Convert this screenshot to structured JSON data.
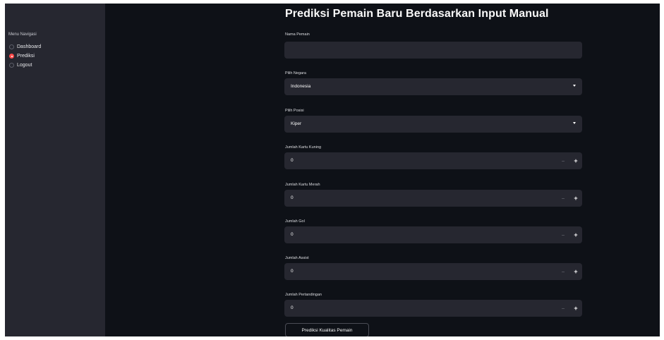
{
  "sidebar": {
    "title": "Menu Navigasi",
    "items": [
      {
        "label": "Dashboard",
        "selected": false
      },
      {
        "label": "Prediksi",
        "selected": true
      },
      {
        "label": "Logout",
        "selected": false
      }
    ]
  },
  "main": {
    "title": "Prediksi Pemain Baru Berdasarkan Input Manual",
    "fields": {
      "nama": {
        "label": "Nama Pemain",
        "value": ""
      },
      "negara": {
        "label": "Pilih Negara",
        "value": "Indonesia"
      },
      "posisi": {
        "label": "Pilih Posisi",
        "value": "Kiper"
      },
      "kartu_kuning": {
        "label": "Jumlah Kartu Kuning",
        "value": "0"
      },
      "kartu_merah": {
        "label": "Jumlah Kartu Merah",
        "value": "0"
      },
      "gol": {
        "label": "Jumlah Gol",
        "value": "0"
      },
      "assist": {
        "label": "Jumlah Assist",
        "value": "0"
      },
      "pertandingan": {
        "label": "Jumlah Pertandingan",
        "value": "0"
      }
    },
    "stepper": {
      "minus": "−",
      "plus": "+"
    },
    "submit_label": "Prediksi Kualitas Pemain"
  },
  "colors": {
    "background": "#0e1117",
    "sidebar": "#262730",
    "input": "#262730",
    "accent": "#ff4b4b",
    "text": "#fafafa"
  }
}
